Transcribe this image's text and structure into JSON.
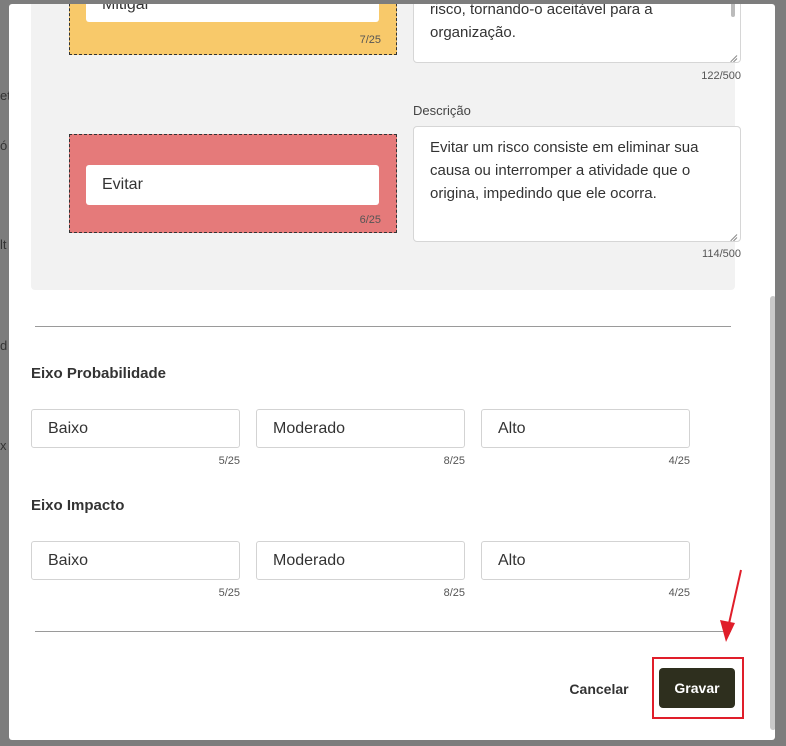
{
  "background": {
    "fragments": [
      "et",
      "ó",
      "lt",
      "d",
      "x"
    ]
  },
  "responses": [
    {
      "name": "Mitigar",
      "name_counter": "7/25",
      "color": "#f8c96a",
      "description": "reduzam a probabilidade ou o impacto do risco, tornando-o aceitável para a organização.",
      "description_counter": "122/500"
    },
    {
      "name": "Evitar",
      "name_counter": "6/25",
      "color": "#e57a7a",
      "description_label": "Descrição",
      "description": "Evitar um risco consiste em eliminar sua causa ou interromper a atividade que o origina, impedindo que ele ocorra.",
      "description_counter": "114/500"
    }
  ],
  "probability_axis": {
    "title": "Eixo Probabilidade",
    "levels": [
      {
        "value": "Baixo",
        "counter": "5/25"
      },
      {
        "value": "Moderado",
        "counter": "8/25"
      },
      {
        "value": "Alto",
        "counter": "4/25"
      }
    ]
  },
  "impact_axis": {
    "title": "Eixo Impacto",
    "levels": [
      {
        "value": "Baixo",
        "counter": "5/25"
      },
      {
        "value": "Moderado",
        "counter": "8/25"
      },
      {
        "value": "Alto",
        "counter": "4/25"
      }
    ]
  },
  "footer": {
    "cancel_label": "Cancelar",
    "save_label": "Gravar",
    "highlight_color": "#e01e2a",
    "save_button_color": "#2e2f1e"
  }
}
